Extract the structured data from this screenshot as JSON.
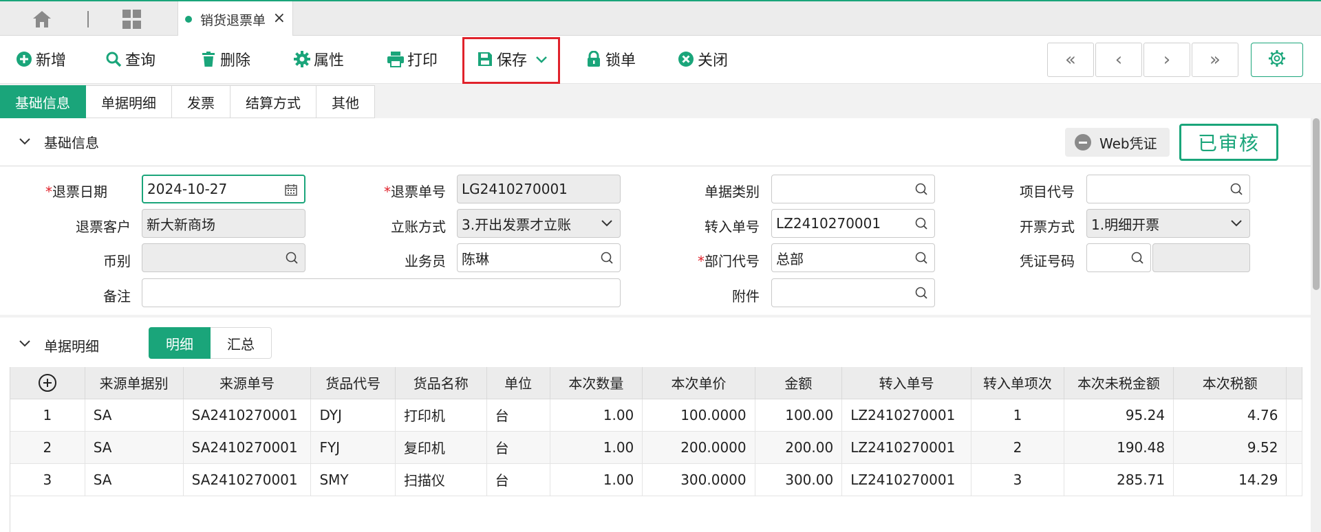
{
  "top_tab": {
    "title": "销货退票单",
    "close": "×"
  },
  "toolbar": {
    "new": "新增",
    "query": "查询",
    "delete": "删除",
    "props": "属性",
    "print": "打印",
    "save": "保存",
    "lock": "锁单",
    "close": "关闭"
  },
  "nav": {
    "first": "«",
    "prev": "‹",
    "next": "›",
    "last": "»"
  },
  "tabs": [
    "基础信息",
    "单据明细",
    "发票",
    "结算方式",
    "其他"
  ],
  "basic": {
    "title": "基础信息",
    "web_voucher": "Web凭证",
    "status": "已审核",
    "fields": {
      "return_date_label": "退票日期",
      "return_date": "2024-10-27",
      "return_no_label": "退票单号",
      "return_no": "LG2410270001",
      "doc_type_label": "单据类别",
      "doc_type": "",
      "project_label": "项目代号",
      "project": "",
      "customer_label": "退票客户",
      "customer": "新大新商场",
      "account_mode_label": "立账方式",
      "account_mode": "3.开出发票才立账",
      "transfer_no_label": "转入单号",
      "transfer_no": "LZ2410270001",
      "invoice_mode_label": "开票方式",
      "invoice_mode": "1.明细开票",
      "currency_label": "币别",
      "currency": "",
      "salesman_label": "业务员",
      "salesman": "陈琳",
      "dept_label": "部门代号",
      "dept": "总部",
      "voucher_label": "凭证号码",
      "voucher": "",
      "remark_label": "备注",
      "remark": "",
      "attach_label": "附件",
      "attach": ""
    }
  },
  "detail": {
    "title": "单据明细",
    "seg_detail": "明细",
    "seg_summary": "汇总",
    "columns": [
      "来源单据别",
      "来源单号",
      "货品代号",
      "货品名称",
      "单位",
      "本次数量",
      "本次单价",
      "金额",
      "转入单号",
      "转入单项次",
      "本次未税金额",
      "本次税额"
    ],
    "rows": [
      {
        "no": "1",
        "src_type": "SA",
        "src_no": "SA2410270001",
        "code": "DYJ",
        "name": "打印机",
        "unit": "台",
        "qty": "1.00",
        "price": "100.0000",
        "amount": "100.00",
        "transfer_no": "LZ2410270001",
        "transfer_seq": "1",
        "net": "95.24",
        "tax": "4.76"
      },
      {
        "no": "2",
        "src_type": "SA",
        "src_no": "SA2410270001",
        "code": "FYJ",
        "name": "复印机",
        "unit": "台",
        "qty": "1.00",
        "price": "200.0000",
        "amount": "200.00",
        "transfer_no": "LZ2410270001",
        "transfer_seq": "2",
        "net": "190.48",
        "tax": "9.52"
      },
      {
        "no": "3",
        "src_type": "SA",
        "src_no": "SA2410270001",
        "code": "SMY",
        "name": "扫描仪",
        "unit": "台",
        "qty": "1.00",
        "price": "300.0000",
        "amount": "300.00",
        "transfer_no": "LZ2410270001",
        "transfer_seq": "3",
        "net": "285.71",
        "tax": "14.29"
      }
    ]
  },
  "colors": {
    "accent": "#1aa57a",
    "required": "#e0222b",
    "highlight_box": "#e0222b"
  }
}
